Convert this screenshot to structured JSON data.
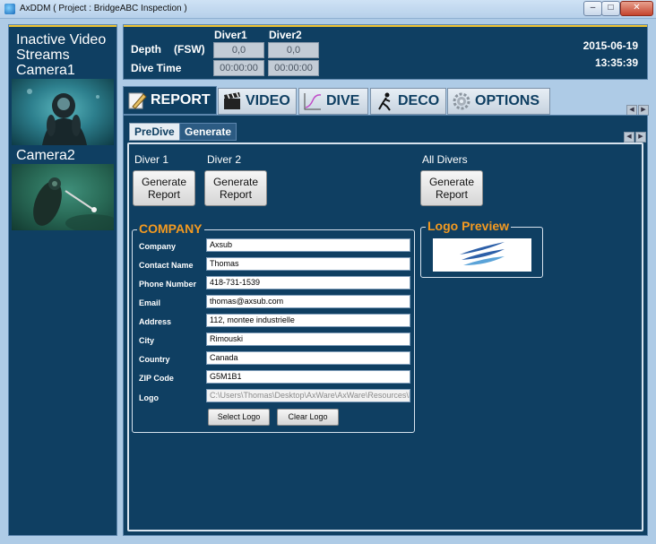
{
  "window": {
    "title": "AxDDM ( Project : BridgeABC Inspection )",
    "min_glyph": "–",
    "max_glyph": "□",
    "close_glyph": "✕"
  },
  "left_panel": {
    "inactive_label": "Inactive Video Streams",
    "camera1_label": "Camera1",
    "camera2_label": "Camera2"
  },
  "header": {
    "depth_label": "Depth",
    "depth_unit": "(FSW)",
    "dive_time_label": "Dive Time",
    "diver1_label": "Diver1",
    "diver2_label": "Diver2",
    "diver1_depth": "0,0",
    "diver2_depth": "0,0",
    "diver1_time": "00:00:00",
    "diver2_time": "00:00:00",
    "date": "2015-06-19",
    "time": "13:35:39"
  },
  "main_tabs": [
    {
      "label": "REPORT",
      "active": true,
      "icon": "pencil-icon"
    },
    {
      "label": "VIDEO",
      "active": false,
      "icon": "clapperboard-icon"
    },
    {
      "label": "DIVE",
      "active": false,
      "icon": "dive-profile-icon"
    },
    {
      "label": "DECO",
      "active": false,
      "icon": "diver-icon"
    },
    {
      "label": "OPTIONS",
      "active": false,
      "icon": "gear-icon"
    }
  ],
  "sub_tabs": [
    {
      "label": "PreDive",
      "active": false
    },
    {
      "label": "Generate",
      "active": true
    }
  ],
  "generate": {
    "diver1_label": "Diver 1",
    "diver2_label": "Diver 2",
    "all_divers_label": "All Divers",
    "generate_button": "Generate\nReport"
  },
  "company": {
    "title": "COMPANY",
    "fields": {
      "company": {
        "label": "Company",
        "value": "Axsub"
      },
      "contact": {
        "label": "Contact Name",
        "value": "Thomas"
      },
      "phone": {
        "label": "Phone Number",
        "value": "418-731-1539"
      },
      "email": {
        "label": "Email",
        "value": "thomas@axsub.com"
      },
      "address": {
        "label": "Address",
        "value": "112, montee industrielle"
      },
      "city": {
        "label": "City",
        "value": "Rimouski"
      },
      "country": {
        "label": "Country",
        "value": "Canada"
      },
      "zip": {
        "label": "ZIP Code",
        "value": "G5M1B1"
      },
      "logo": {
        "label": "Logo",
        "value": "C:\\Users\\Thomas\\Desktop\\AxWare\\AxWare\\Resources\\I"
      }
    },
    "select_logo_button": "Select Logo",
    "clear_logo_button": "Clear Logo"
  },
  "logo_preview": {
    "title": "Logo Preview"
  },
  "colors": {
    "panel_bg": "#0f3f62",
    "accent_orange": "#f39a21",
    "accent_yellow": "#f0c431",
    "window_bg": "#aecbe6"
  }
}
